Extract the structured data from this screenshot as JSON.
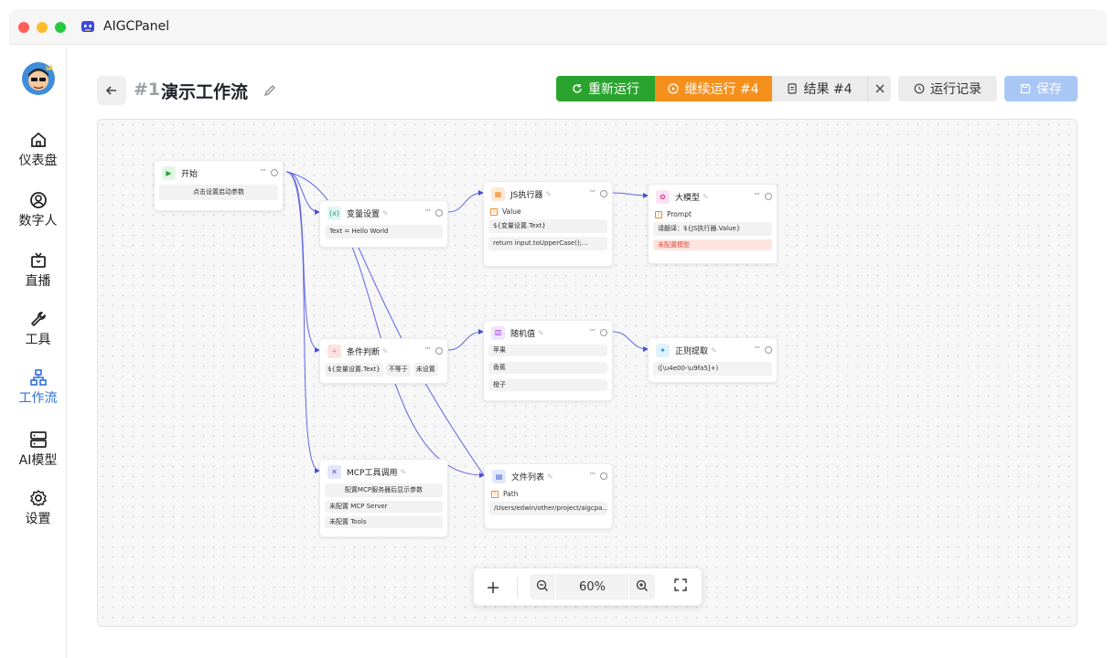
{
  "window": {
    "title": "AIGCPanel",
    "traffic_colors": [
      "#fe5f57",
      "#febc2e",
      "#28c840"
    ]
  },
  "sidebar": {
    "items": [
      {
        "label": "仪表盘",
        "icon": "home-icon"
      },
      {
        "label": "数字人",
        "icon": "user-icon"
      },
      {
        "label": "直播",
        "icon": "tv-icon"
      },
      {
        "label": "工具",
        "icon": "wrench-icon"
      },
      {
        "label": "工作流",
        "icon": "workflow-icon",
        "active": true
      },
      {
        "label": "AI模型",
        "icon": "server-icon"
      },
      {
        "label": "设置",
        "icon": "gear-icon"
      }
    ]
  },
  "header": {
    "workflow_number": "#1",
    "workflow_title": "演示工作流",
    "rerun_label": "重新运行",
    "continue_label": "继续运行 #4",
    "result_label": "结果 #4",
    "history_label": "运行记录",
    "save_label": "保存"
  },
  "colors": {
    "accent": "#2f6fd8",
    "rerun": "#2aa42f",
    "continue": "#f5901d",
    "save": "#a9c6f5",
    "edge": "#5b5fe0"
  },
  "nodes": {
    "start": {
      "title": "开始",
      "param": "点击设置启动参数"
    },
    "variable": {
      "title": "变量设置",
      "value": "Text = Hello World"
    },
    "js": {
      "title": "JS执行器",
      "field_label": "Value",
      "value": "${变量设置.Text}",
      "code": "return input.toUpperCase();..."
    },
    "llm": {
      "title": "大模型",
      "field_label": "Prompt",
      "value": "请翻译：${JS执行器.Value}",
      "warning": "未配置模型"
    },
    "condition": {
      "title": "条件判断",
      "left": "${变量设置.Text}",
      "op": "不等于",
      "right": "未设置"
    },
    "random": {
      "title": "随机值",
      "options": [
        "苹果",
        "香蕉",
        "橙子"
      ]
    },
    "regex": {
      "title": "正则提取",
      "pattern": "([\\u4e00-\\u9fa5]+)"
    },
    "mcp": {
      "title": "MCP工具调用",
      "hint": "配置MCP服务器后显示参数",
      "server": "未配置 MCP Server",
      "tools": "未配置 Tools"
    },
    "files": {
      "title": "文件列表",
      "field_label": "Path",
      "value": "/Users/edwin/other/project/aigcpa..."
    }
  },
  "zoom": {
    "level": "60%"
  }
}
